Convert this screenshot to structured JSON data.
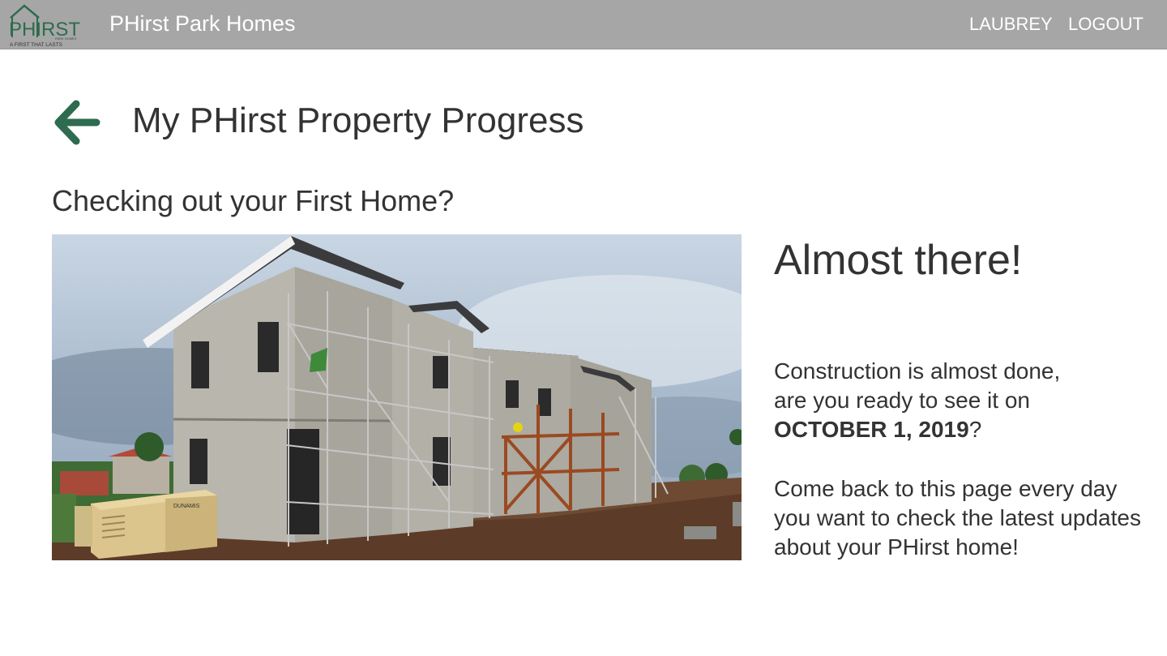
{
  "header": {
    "logo": {
      "wordmark": "PHIRST",
      "small_text": "PARK HOMES",
      "tagline": "A FIRST THAT LASTS"
    },
    "title": "PHirst Park Homes",
    "user_label": "LAUBREY",
    "logout_label": "LOGOUT"
  },
  "page": {
    "title": "My PHirst Property Progress",
    "subtitle": "Checking out your First Home?"
  },
  "status": {
    "heading": "Almost there!",
    "line1": "Construction is almost done,",
    "line2": "are you ready to see it on",
    "date": "OCTOBER 1, 2019",
    "date_suffix": "?",
    "revisit_message": "Come back to this page every day you want to check the latest updates about your PHirst home!"
  },
  "photo": {
    "generator_brand": "DUNAMIS"
  },
  "icons": {
    "back": "arrow-left-icon"
  },
  "colors": {
    "topbar": "#a6a6a6",
    "brand_green": "#2e6b4f",
    "text": "#333333"
  }
}
